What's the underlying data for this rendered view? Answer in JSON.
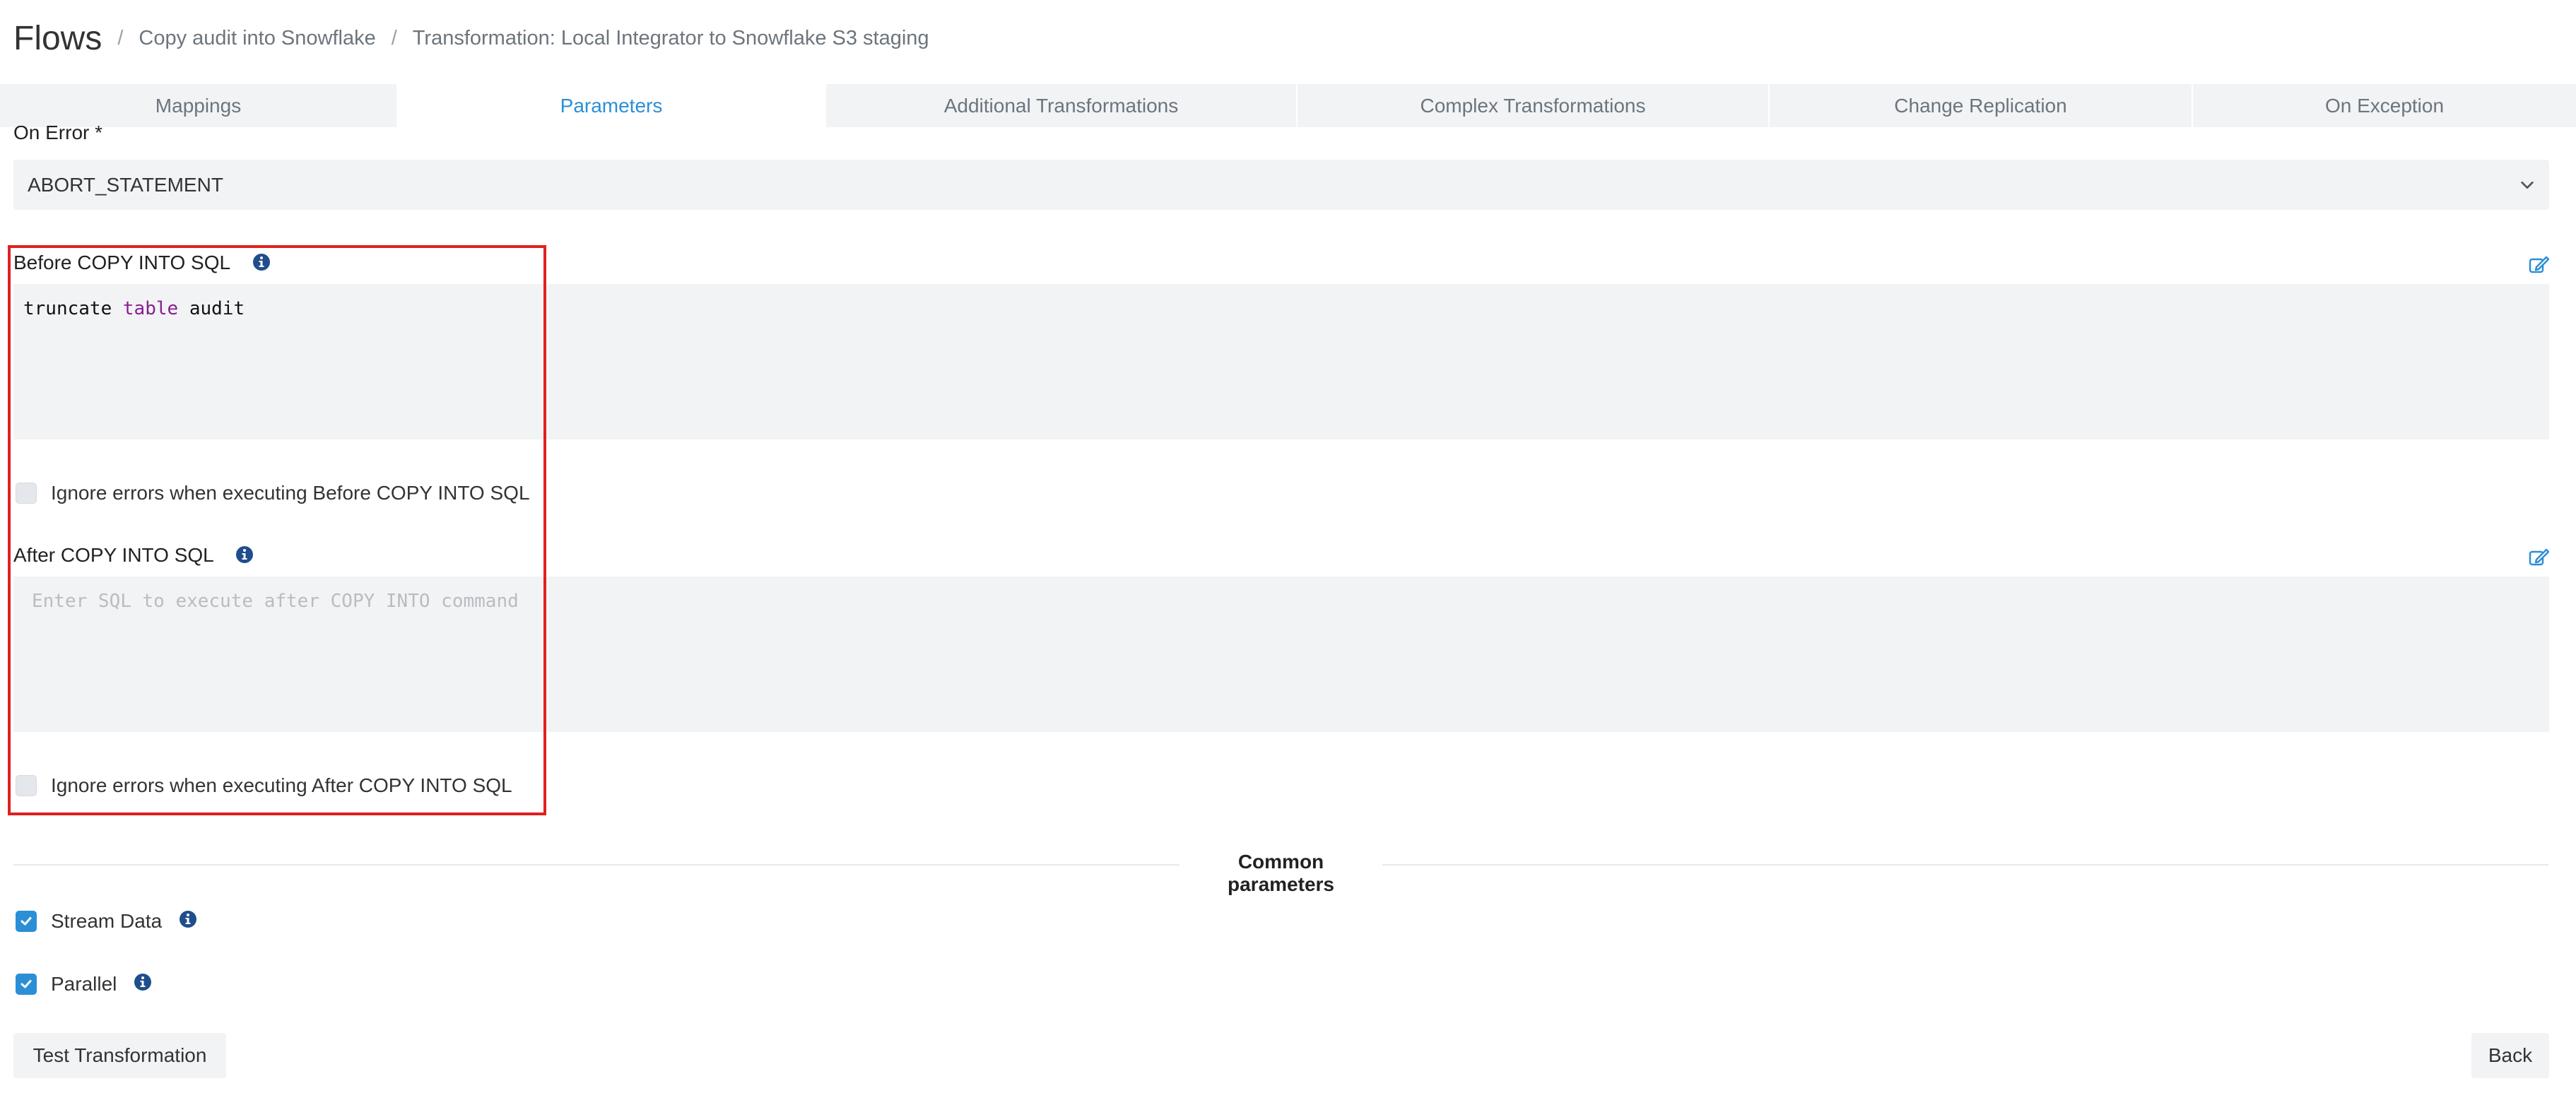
{
  "header": {
    "title": "Flows",
    "breadcrumb": [
      "Copy audit into Snowflake",
      "Transformation: Local Integrator to Snowflake S3 staging"
    ]
  },
  "tabs": [
    {
      "label": "Mappings",
      "active": false
    },
    {
      "label": "Parameters",
      "active": true
    },
    {
      "label": "Additional Transformations",
      "active": false
    },
    {
      "label": "Complex Transformations",
      "active": false
    },
    {
      "label": "Change Replication",
      "active": false
    },
    {
      "label": "On Exception",
      "active": false
    }
  ],
  "on_error": {
    "label": "On Error *",
    "value": "ABORT_STATEMENT"
  },
  "before_sql": {
    "label": "Before COPY INTO SQL",
    "code_tokens": [
      "truncate",
      "table",
      "audit"
    ],
    "ignore_errors_label": "Ignore errors when executing Before COPY INTO SQL",
    "ignore_errors_checked": false
  },
  "after_sql": {
    "label": "After COPY INTO SQL",
    "placeholder": "Enter SQL to execute after COPY INTO command",
    "ignore_errors_label": "Ignore errors when executing After COPY INTO SQL",
    "ignore_errors_checked": false
  },
  "common": {
    "title": "Common parameters",
    "stream_data_label": "Stream Data",
    "stream_data_checked": true,
    "parallel_label": "Parallel",
    "parallel_checked": true
  },
  "buttons": {
    "test": "Test Transformation",
    "back": "Back"
  },
  "colors": {
    "accent": "#2b8fd6",
    "highlight": "#e02020",
    "info_icon": "#1f4e8c",
    "sql_keyword": "#8a1f8e"
  },
  "icons": [
    "info-icon",
    "edit-icon",
    "chevron-down-icon",
    "checkmark-icon"
  ]
}
